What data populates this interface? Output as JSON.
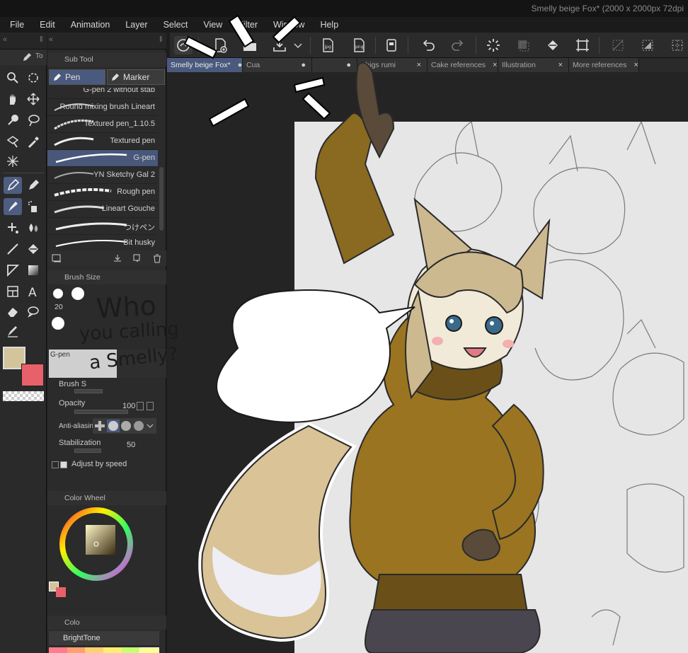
{
  "window": {
    "title": "Smelly beige Fox* (2000 x 2000px 72dpi"
  },
  "menu": [
    "File",
    "Edit",
    "Animation",
    "Layer",
    "Select",
    "View",
    "Filter",
    "Window",
    "Help"
  ],
  "tabs": [
    {
      "label": "Smelly beige Fox*",
      "marker": "●"
    },
    {
      "label": "Cua",
      "marker": "●"
    },
    {
      "label": "",
      "marker": "●"
    },
    {
      "label": "Thigs rumi",
      "marker": "×"
    },
    {
      "label": "Cake references",
      "marker": "×"
    },
    {
      "label": "Illustration",
      "marker": "×"
    },
    {
      "label": "More references",
      "marker": "×"
    }
  ],
  "subtool": {
    "title": "Sub Tool",
    "tool_tab": "To",
    "groups": [
      "Pen",
      "Marker"
    ],
    "brushes": [
      "G-pen 2 without stab",
      "Round mixing brush Lineart",
      "Textured pen_1.10.5",
      "Textured pen",
      "G-pen",
      "YN Sketchy Gal 2",
      "Rough pen",
      "Lineart Gouche",
      "つけペン",
      "Bit husky"
    ],
    "selected_brush": "G-pen"
  },
  "brush_size": {
    "title": "Brush Size",
    "value": "20"
  },
  "tool_property": {
    "tool_name": "G-pen",
    "brush_size_label": "Brush S",
    "opacity_label": "Opacity",
    "opacity_value": "100",
    "antialiasing_label": "Anti-aliasing",
    "stabilization_label": "Stabilization",
    "stabilization_value": "50",
    "adjust_label": "Adjust by speed"
  },
  "color_wheel": {
    "title": "Color Wheel"
  },
  "color_set": {
    "title": "Colo",
    "set_name": "BrightTone"
  },
  "colors": {
    "main": "#d4c49c",
    "sub": "#e8606a",
    "accent": "#4a5a7e"
  },
  "speech_bubble": {
    "line1": "Who",
    "line2": "you calling",
    "line3": "a Smelly?"
  }
}
